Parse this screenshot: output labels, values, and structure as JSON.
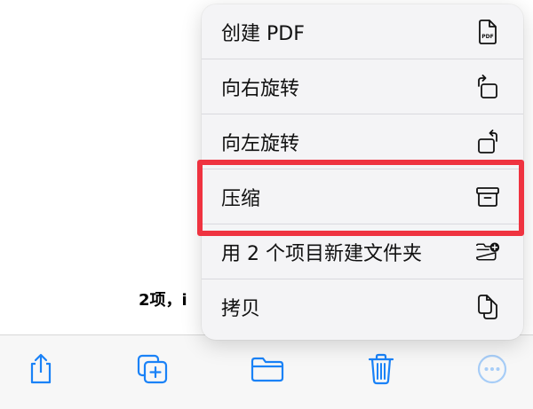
{
  "background": {
    "status_text": "2项，i"
  },
  "menu": {
    "items": [
      {
        "label": "创建 PDF",
        "icon": "pdf-icon"
      },
      {
        "label": "向右旋转",
        "icon": "rotate-right-icon"
      },
      {
        "label": "向左旋转",
        "icon": "rotate-left-icon"
      },
      {
        "label": "压缩",
        "icon": "archive-box-icon"
      },
      {
        "label": "用 2 个项目新建文件夹",
        "icon": "folder-badge-plus-icon"
      },
      {
        "label": "拷贝",
        "icon": "copy-docs-icon"
      }
    ],
    "pdf_icon_text": "PDF"
  },
  "toolbar": {
    "items": [
      "share-icon",
      "duplicate-icon",
      "folder-icon",
      "trash-icon",
      "more-icon"
    ]
  },
  "colors": {
    "accent": "#1a82f7",
    "highlight": "#ef3340",
    "more_disabled": "#a7cdf7"
  }
}
